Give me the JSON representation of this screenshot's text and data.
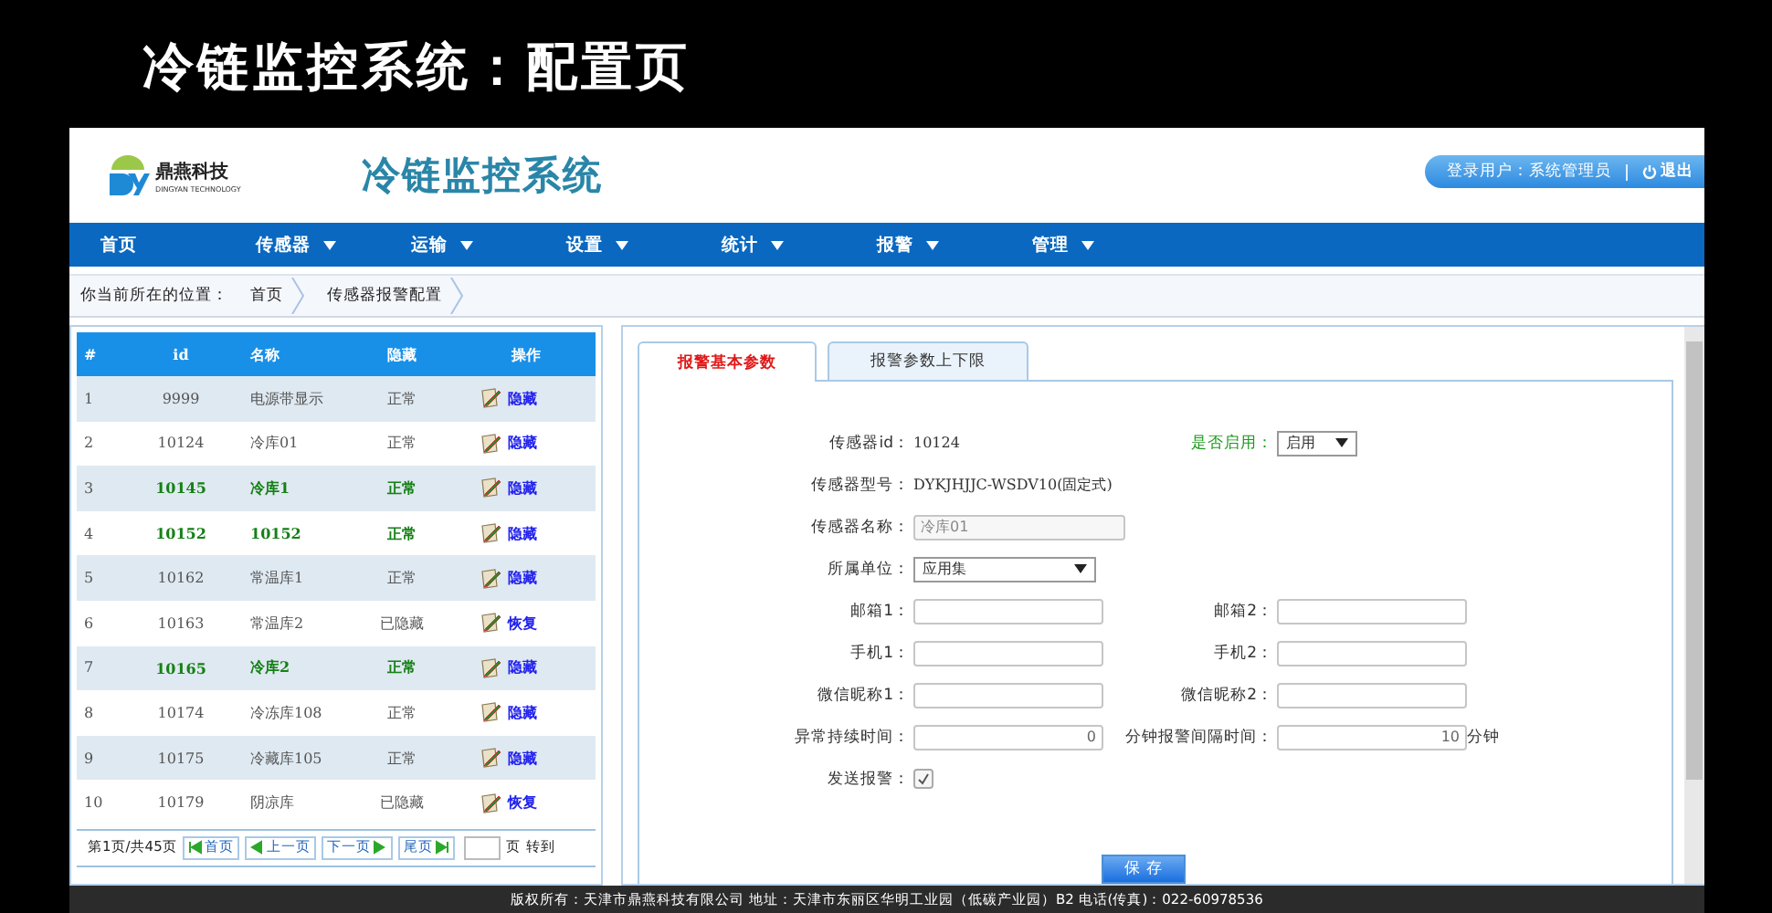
{
  "page_title": "冷链监控系统：配置页",
  "header": {
    "logo_name": "鼎燕科技",
    "logo_sub": "DINGYAN TECHNOLOGY",
    "system_title": "冷链监控系统",
    "user_label": "登录用户：系统管理员",
    "logout": "退出"
  },
  "nav": [
    {
      "label": "首页",
      "has_menu": false
    },
    {
      "label": "传感器",
      "has_menu": true
    },
    {
      "label": "运输",
      "has_menu": true
    },
    {
      "label": "设置",
      "has_menu": true
    },
    {
      "label": "统计",
      "has_menu": true
    },
    {
      "label": "报警",
      "has_menu": true
    },
    {
      "label": "管理",
      "has_menu": true
    }
  ],
  "breadcrumb": {
    "prefix": "你当前所在的位置：",
    "items": [
      "首页",
      "传感器报警配置"
    ]
  },
  "table": {
    "columns": [
      "#",
      "id",
      "名称",
      "隐藏",
      "操作"
    ],
    "rows": [
      {
        "no": "1",
        "id": "9999",
        "name": "电源带显示",
        "status": "正常",
        "action": "隐藏",
        "highlighted": false
      },
      {
        "no": "2",
        "id": "10124",
        "name": "冷库01",
        "status": "正常",
        "action": "隐藏",
        "highlighted": false
      },
      {
        "no": "3",
        "id": "10145",
        "name": "冷库1",
        "status": "正常",
        "action": "隐藏",
        "highlighted": true
      },
      {
        "no": "4",
        "id": "10152",
        "name": "10152",
        "status": "正常",
        "action": "隐藏",
        "highlighted": true
      },
      {
        "no": "5",
        "id": "10162",
        "name": "常温库1",
        "status": "正常",
        "action": "隐藏",
        "highlighted": false
      },
      {
        "no": "6",
        "id": "10163",
        "name": "常温库2",
        "status": "已隐藏",
        "action": "恢复",
        "highlighted": false
      },
      {
        "no": "7",
        "id": "10165",
        "name": "冷库2",
        "status": "正常",
        "action": "隐藏",
        "highlighted": true
      },
      {
        "no": "8",
        "id": "10174",
        "name": "冷冻库108",
        "status": "正常",
        "action": "隐藏",
        "highlighted": false
      },
      {
        "no": "9",
        "id": "10175",
        "name": "冷藏库105",
        "status": "正常",
        "action": "隐藏",
        "highlighted": false
      },
      {
        "no": "10",
        "id": "10179",
        "name": "阴凉库",
        "status": "已隐藏",
        "action": "恢复",
        "highlighted": false
      }
    ]
  },
  "pagination": {
    "info": "第1页/共45页",
    "buttons": [
      {
        "label": "首页",
        "kind": "first"
      },
      {
        "label": "上一页",
        "kind": "prev"
      },
      {
        "label": "下一页",
        "kind": "next"
      },
      {
        "label": "尾页",
        "kind": "last"
      }
    ],
    "page_suffix": "页",
    "go": "转到"
  },
  "form": {
    "tabs": [
      {
        "label": "报警基本参数",
        "selected": true
      },
      {
        "label": "报警参数上下限",
        "selected": false
      }
    ],
    "sensor_id": {
      "label": "传感器id：",
      "value": "10124"
    },
    "enabled": {
      "label": "是否启用：",
      "value": "启用"
    },
    "model": {
      "label": "传感器型号：",
      "value": "DYKJHJJC-WSDV10(固定式)"
    },
    "name": {
      "label": "传感器名称：",
      "value": "冷库01",
      "disabled": true
    },
    "unit": {
      "label": "所属单位：",
      "value": "应用集"
    },
    "pairs": [
      {
        "label1": "邮箱1：",
        "label2": "邮箱2："
      },
      {
        "label1": "手机1：",
        "label2": "手机2："
      },
      {
        "label1": "微信昵称1：",
        "label2": "微信昵称2："
      }
    ],
    "duration": {
      "label": "异常持续时间：",
      "value": "0"
    },
    "interval": {
      "label": "分钟报警间隔时间：",
      "value": "10",
      "unit": "分钟"
    },
    "send_alarm": {
      "label": "发送报警：",
      "checked": true
    },
    "save": "保 存"
  },
  "footer": "版权所有：天津市鼎燕科技有限公司 地址：天津市东丽区华明工业园（低碳产业园）B2 电话(传真)：022-60978536"
}
